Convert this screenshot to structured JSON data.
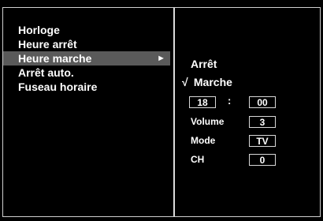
{
  "menu": {
    "items": [
      {
        "label": "Horloge"
      },
      {
        "label": "Heure arrêt"
      },
      {
        "label": "Heure marche",
        "arrow": "►"
      },
      {
        "label": "Arrêt auto."
      },
      {
        "label": "Fuseau horaire"
      }
    ]
  },
  "submenu": {
    "off_label": "Arrêt",
    "on_label": "Marche",
    "check_mark": "√",
    "hour": "18",
    "separator": ":",
    "minute": "00",
    "volume_label": "Volume",
    "volume_value": "3",
    "mode_label": "Mode",
    "mode_value": "TV",
    "ch_label": "CH",
    "ch_value": "0"
  },
  "colors": {
    "background": "#000000",
    "text": "#ffffff",
    "highlight": "#5a5a5a",
    "border": "#cfcfcf"
  }
}
